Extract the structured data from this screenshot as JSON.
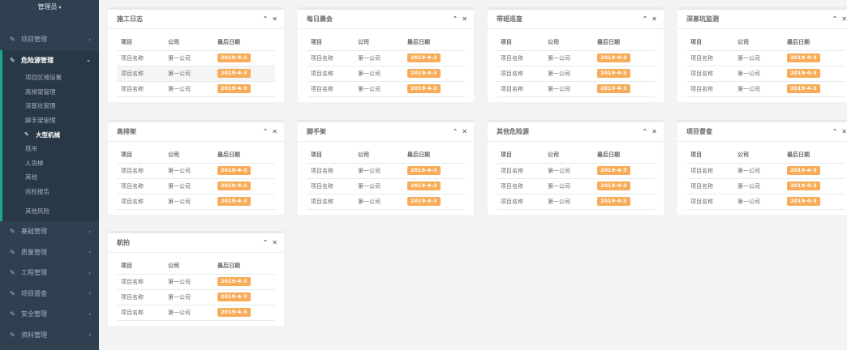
{
  "sidebar": {
    "user": "管理员",
    "items_top": [
      {
        "label": "项目管理"
      }
    ],
    "open_group": {
      "label": "危险源管理",
      "sub_items": [
        {
          "label": "项目区域设置"
        },
        {
          "label": "高排架管理"
        },
        {
          "label": "深基坑管理"
        },
        {
          "label": "脚手架管理"
        },
        {
          "label": "大型机械"
        },
        {
          "label": "塔吊"
        },
        {
          "label": "人货梯"
        },
        {
          "label": "其他"
        },
        {
          "label": "巡检报告"
        },
        {
          "label": "其他风险"
        }
      ]
    },
    "items_bottom": [
      {
        "label": "基础管理"
      },
      {
        "label": "质量管理"
      },
      {
        "label": "工程管理"
      },
      {
        "label": "项目督查"
      },
      {
        "label": "安全管理"
      },
      {
        "label": "资料管理"
      }
    ]
  },
  "table_headers": [
    "项目",
    "公司",
    "最后日期"
  ],
  "panels": [
    {
      "title": "施工日志",
      "rows": [
        [
          "项目名称",
          "第一公司",
          "2019-4-3"
        ],
        [
          "项目名称",
          "第一公司",
          "2019-4-3"
        ],
        [
          "项目名称",
          "第一公司",
          "2019-4-3"
        ]
      ]
    },
    {
      "title": "每日晨会",
      "rows": [
        [
          "项目名称",
          "第一公司",
          "2019-4-3"
        ],
        [
          "项目名称",
          "第一公司",
          "2019-4-3"
        ],
        [
          "项目名称",
          "第一公司",
          "2019-4-3"
        ]
      ]
    },
    {
      "title": "带班巡查",
      "rows": [
        [
          "项目名称",
          "第一公司",
          "2019-4-3"
        ],
        [
          "项目名称",
          "第一公司",
          "2019-4-3"
        ],
        [
          "项目名称",
          "第一公司",
          "2019-4-3"
        ]
      ]
    },
    {
      "title": "深基坑监测",
      "rows": [
        [
          "项目名称",
          "第一公司",
          "2019-4-3"
        ],
        [
          "项目名称",
          "第一公司",
          "2019-4-3"
        ],
        [
          "项目名称",
          "第一公司",
          "2019-4-3"
        ]
      ]
    },
    {
      "title": "高排架",
      "rows": [
        [
          "项目名称",
          "第一公司",
          "2019-4-3"
        ],
        [
          "项目名称",
          "第一公司",
          "2019-4-3"
        ],
        [
          "项目名称",
          "第一公司",
          "2019-4-3"
        ]
      ]
    },
    {
      "title": "脚手架",
      "rows": [
        [
          "项目名称",
          "第一公司",
          "2019-4-3"
        ],
        [
          "项目名称",
          "第一公司",
          "2019-4-3"
        ],
        [
          "项目名称",
          "第一公司",
          "2019-4-3"
        ]
      ]
    },
    {
      "title": "其他危险源",
      "rows": [
        [
          "项目名称",
          "第一公司",
          "2019-4-3"
        ],
        [
          "项目名称",
          "第一公司",
          "2019-4-3"
        ],
        [
          "项目名称",
          "第一公司",
          "2019-4-3"
        ]
      ]
    },
    {
      "title": "项目督查",
      "rows": [
        [
          "项目名称",
          "第一公司",
          "2019-4-3"
        ],
        [
          "项目名称",
          "第一公司",
          "2019-4-3"
        ],
        [
          "项目名称",
          "第一公司",
          "2019-4-3"
        ]
      ]
    },
    {
      "title": "航拍",
      "rows": [
        [
          "项目名称",
          "第一公司",
          "2019-4-3"
        ],
        [
          "项目名称",
          "第一公司",
          "2019-4-3"
        ],
        [
          "项目名称",
          "第一公司",
          "2019-4-3"
        ]
      ]
    }
  ],
  "icons": {
    "nav_icon": "edit-icon",
    "collapse": "chevron-up-icon",
    "close": "close-icon"
  },
  "colors": {
    "sidebar_bg": "#2f4050",
    "accent": "#19aa8d",
    "badge": "#f8ac59"
  }
}
